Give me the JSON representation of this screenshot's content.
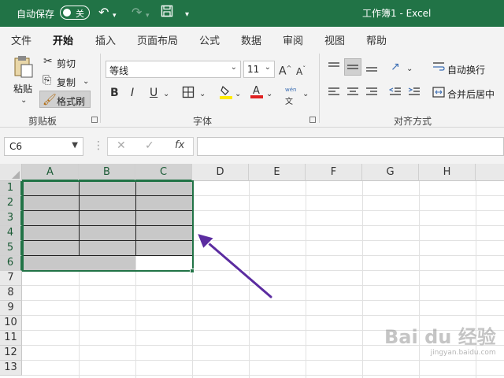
{
  "titlebar": {
    "autosave_label": "自动保存",
    "autosave_state": "关",
    "window_title": "工作簿1  -  Excel"
  },
  "qat": {
    "undo_icon": "undo-icon",
    "redo_icon": "redo-icon",
    "save_icon": "save-icon",
    "customize_icon": "chevron-down-icon"
  },
  "tabs": [
    "文件",
    "开始",
    "插入",
    "页面布局",
    "公式",
    "数据",
    "审阅",
    "视图",
    "帮助"
  ],
  "active_tab": "开始",
  "ribbon": {
    "clipboard": {
      "paste": "粘贴",
      "cut": "剪切",
      "copy": "复制",
      "format_painter": "格式刷",
      "group": "剪贴板"
    },
    "font": {
      "font_name": "等线",
      "font_size": "11",
      "bold": "B",
      "italic": "I",
      "underline": "U",
      "grow": "A^",
      "shrink": "A˅",
      "phonetic_top": "wén",
      "phonetic_bottom": "文",
      "group": "字体"
    },
    "alignment": {
      "wrap_text": "自动换行",
      "merge_center": "合并后居中",
      "group": "对齐方式"
    }
  },
  "formula_bar": {
    "name_box": "C6",
    "cancel": "✕",
    "enter": "✓",
    "fx": "fx",
    "value": ""
  },
  "sheet": {
    "columns": [
      "A",
      "B",
      "C",
      "D",
      "E",
      "F",
      "G",
      "H"
    ],
    "rows": [
      "1",
      "2",
      "3",
      "4",
      "5",
      "6",
      "7",
      "8",
      "9",
      "10",
      "11",
      "12",
      "13"
    ],
    "selection": "A1:C6",
    "active_cell": "C6"
  },
  "watermark": {
    "brand": "Bai du 经验",
    "url": "jingyan.baidu.com"
  },
  "colors": {
    "accent": "#217346",
    "shade": "#c8c8c8",
    "arrow": "#5b2ca0"
  }
}
